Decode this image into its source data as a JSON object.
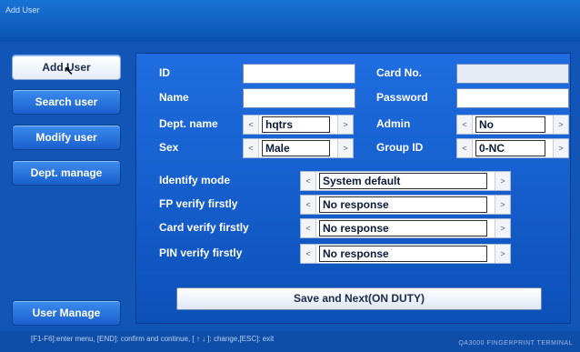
{
  "window": {
    "title": "Add User"
  },
  "nav": {
    "add_user": "Add User",
    "search_user": "Search user",
    "modify_user": "Modify user",
    "dept_manage": "Dept. manage",
    "user_manage": "User Manage"
  },
  "form": {
    "id_label": "ID",
    "id_value": "",
    "card_no_label": "Card No.",
    "card_no_value": "",
    "name_label": "Name",
    "name_value": "",
    "password_label": "Password",
    "password_value": "",
    "dept_name_label": "Dept. name",
    "dept_name_value": "hqtrs",
    "admin_label": "Admin",
    "admin_value": "No",
    "sex_label": "Sex",
    "sex_value": "Male",
    "group_id_label": "Group ID",
    "group_id_value": "0-NC",
    "identify_mode_label": "Identify mode",
    "identify_mode_value": "System default",
    "fp_verify_label": "FP verify firstly",
    "fp_verify_value": "No response",
    "card_verify_label": "Card verify firstly",
    "card_verify_value": "No response",
    "pin_verify_label": "PIN verify firstly",
    "pin_verify_value": "No response",
    "save_button": "Save and Next(ON DUTY)"
  },
  "spinner": {
    "left": "<",
    "right": ">"
  },
  "status": {
    "hint": "[F1-F6]:enter menu, [END]: confirm and continue, [ ↑ ↓ ]: change,[ESC]: exit",
    "brand": "QA3000 FINGERPRINT TERMINAL"
  }
}
